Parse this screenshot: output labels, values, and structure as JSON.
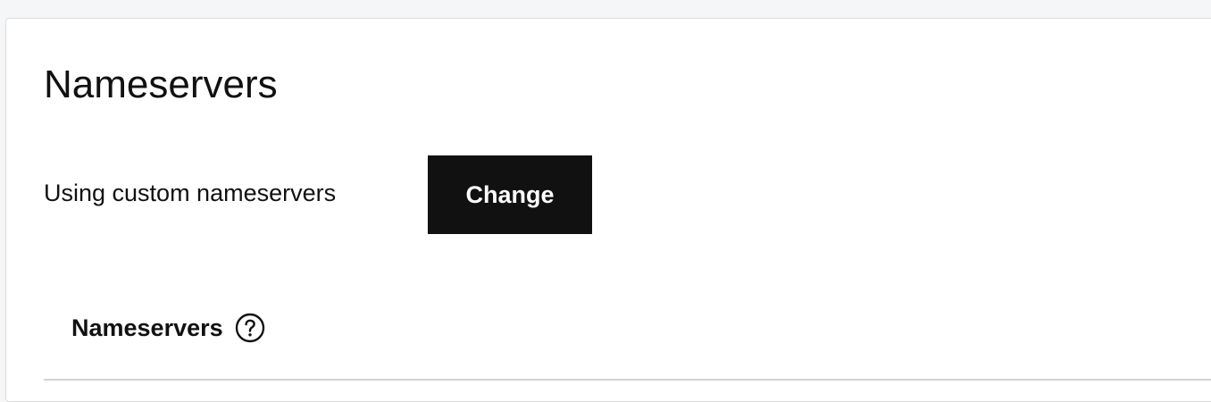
{
  "card": {
    "title": "Nameservers",
    "status": {
      "text": "Using custom nameservers",
      "change_label": "Change"
    },
    "section": {
      "label": "Nameservers",
      "help_icon": "question-circle-icon"
    }
  },
  "colors": {
    "button_bg": "#111111",
    "button_text": "#ffffff",
    "page_bg": "#f5f6f7",
    "card_bg": "#ffffff"
  }
}
